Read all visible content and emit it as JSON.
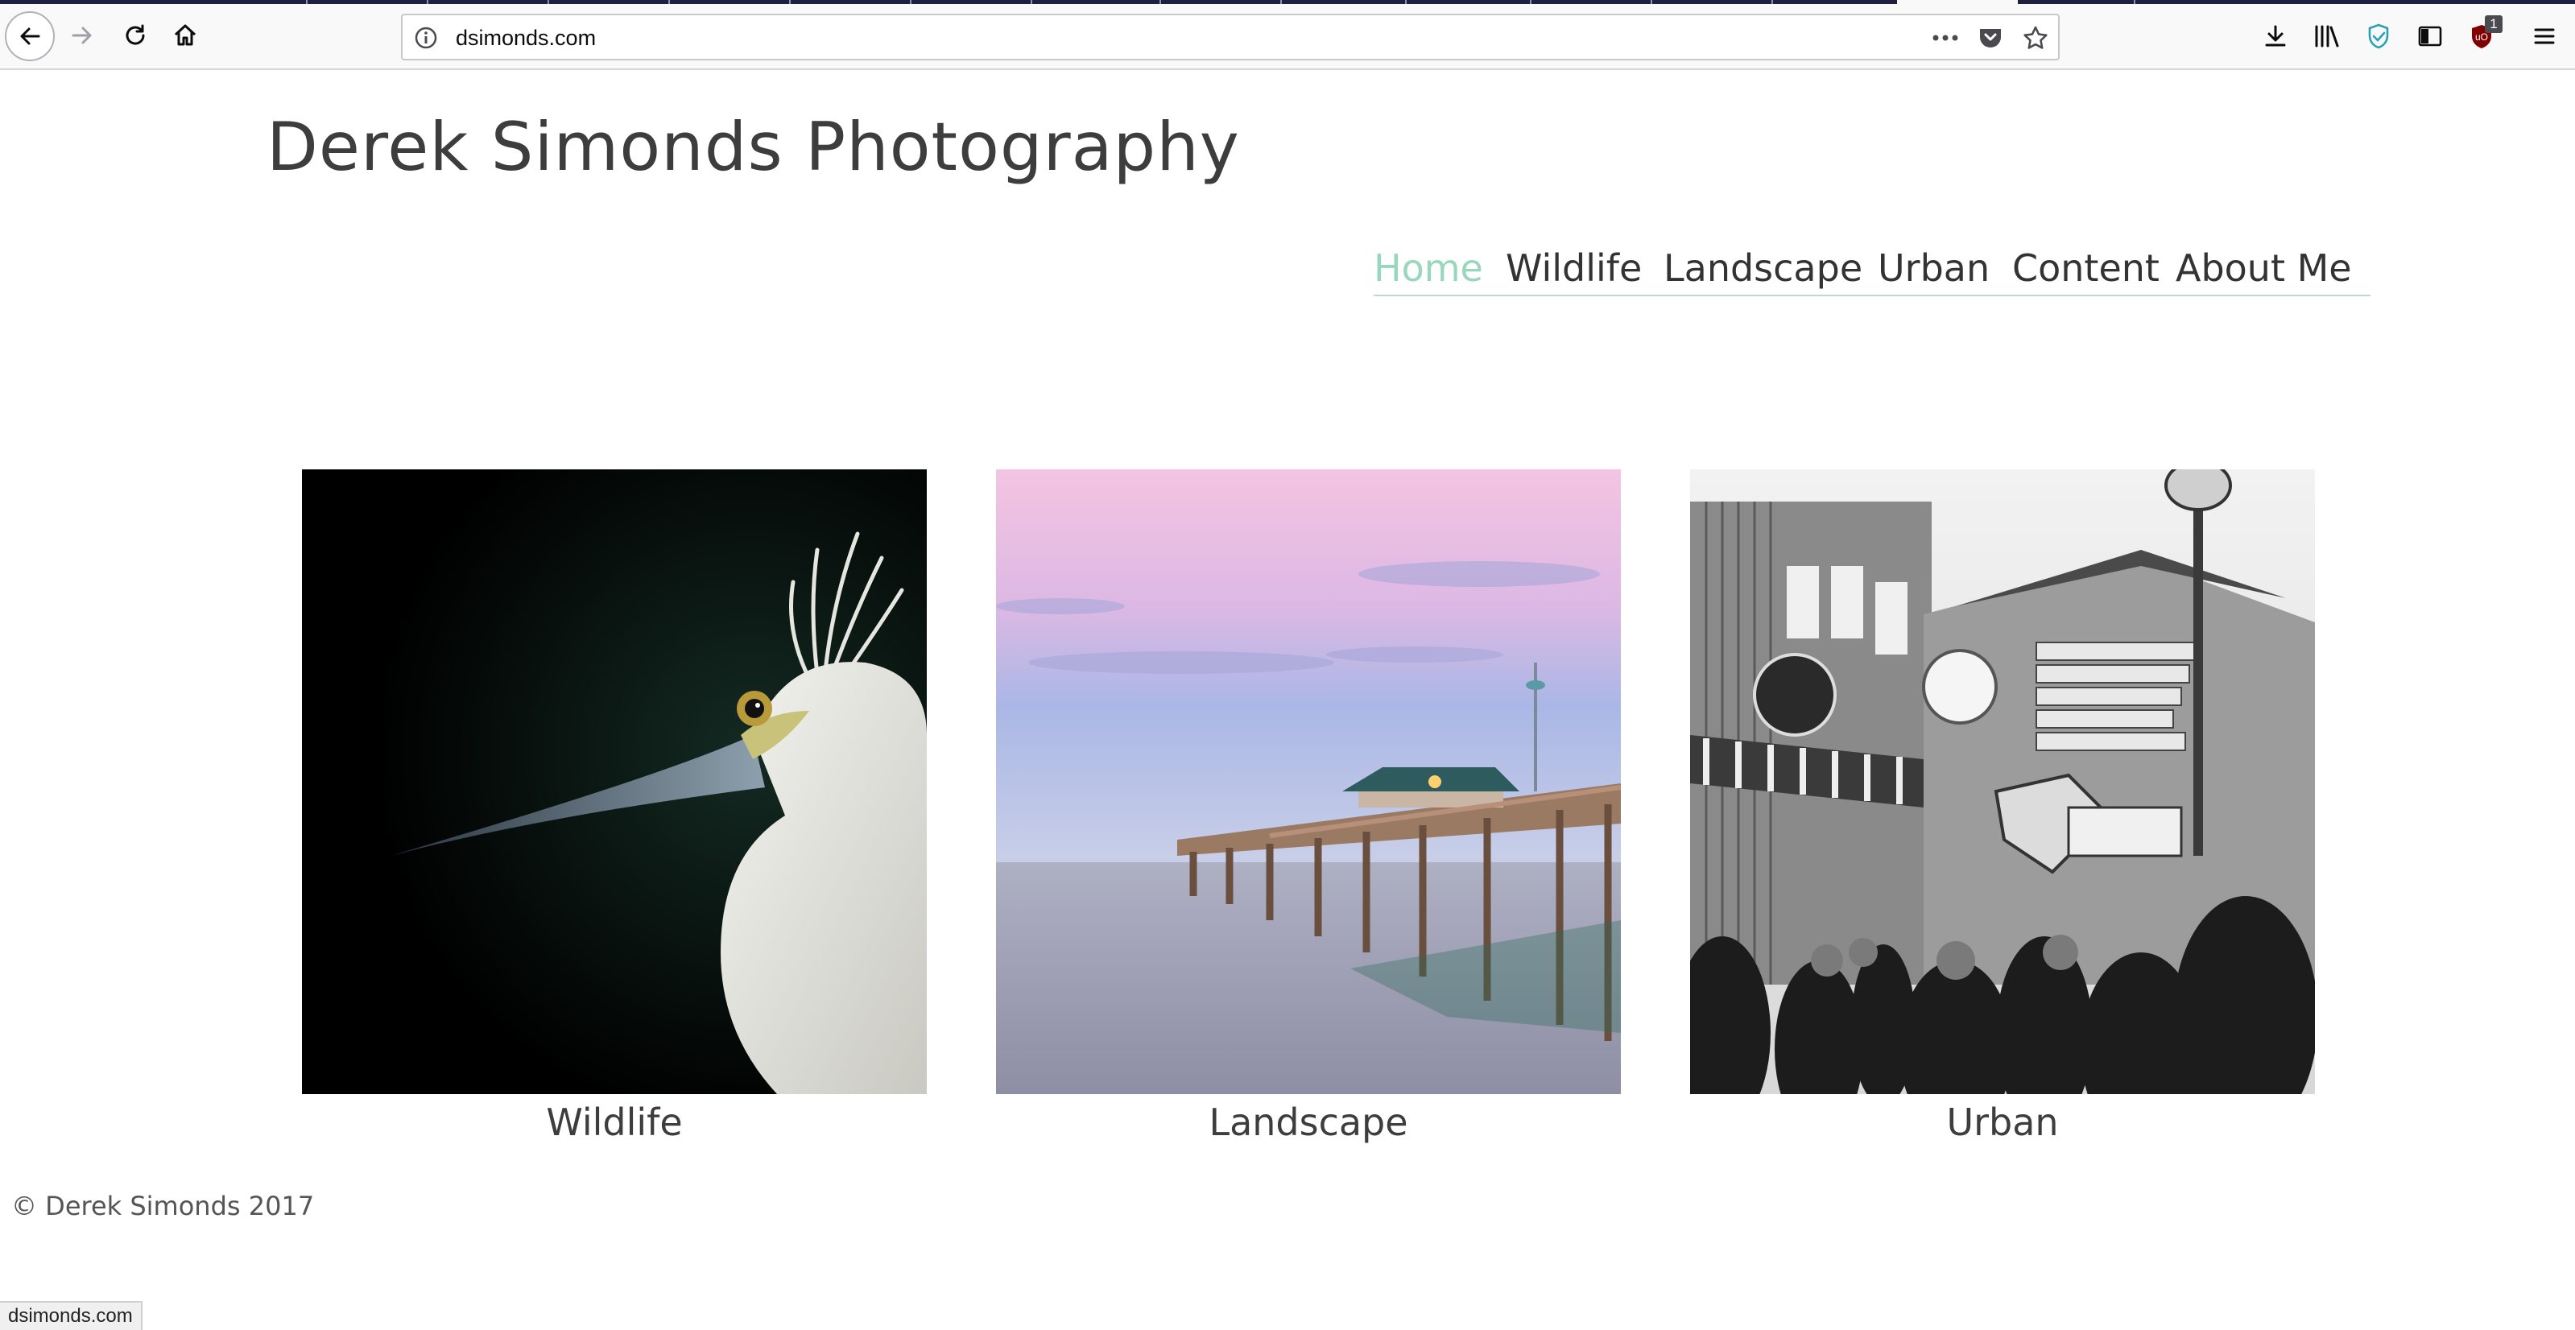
{
  "browser": {
    "url": "dsimonds.com",
    "toolbar_icons": [
      "back-icon",
      "forward-icon",
      "reload-icon",
      "home-icon",
      "page-info-icon",
      "page-actions-icon",
      "pocket-icon",
      "bookmark-star-icon",
      "downloads-icon",
      "library-icon",
      "extension-shield-icon",
      "sidebar-icon",
      "ublock-icon",
      "hamburger-menu-icon"
    ],
    "extension_badge": "1",
    "status_text": "dsimonds.com"
  },
  "site": {
    "title": "Derek Simonds Photography",
    "nav": {
      "items": [
        {
          "label": "Home",
          "active": true
        },
        {
          "label": "Wildlife",
          "active": false
        },
        {
          "label": "Landscape",
          "active": false
        },
        {
          "label": "Urban",
          "active": false
        },
        {
          "label": "Content",
          "active": false
        },
        {
          "label": "About Me",
          "active": false
        }
      ]
    },
    "gallery": [
      {
        "caption": "Wildlife"
      },
      {
        "caption": "Landscape"
      },
      {
        "caption": "Urban"
      }
    ],
    "footer": "© Derek Simonds 2017"
  },
  "colors": {
    "accent_active_nav": "#99d7bd",
    "nav_underline": "#b8dccd",
    "text": "#3d3d3d"
  }
}
